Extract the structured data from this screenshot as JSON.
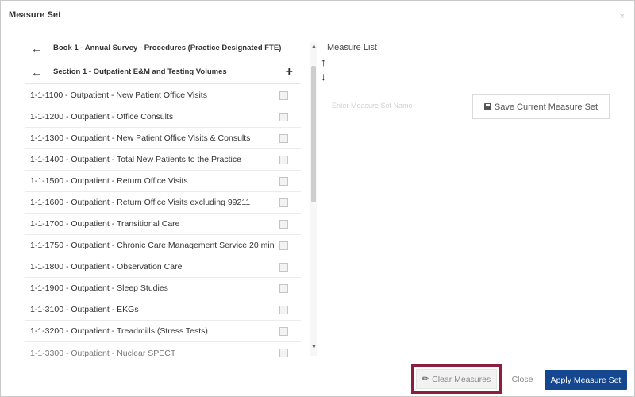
{
  "modal": {
    "title": "Measure Set",
    "close_glyph": "×"
  },
  "left": {
    "book": {
      "back_icon": "←",
      "label": "Book 1 - Annual Survey - Procedures (Practice Designated FTE)"
    },
    "section": {
      "back_icon": "←",
      "label": "Section 1 - Outpatient E&M and Testing Volumes",
      "add_icon": "+"
    },
    "measures": [
      "1-1-1100 - Outpatient - New Patient Office Visits",
      "1-1-1200 - Outpatient - Office Consults",
      "1-1-1300 - Outpatient - New Patient Office Visits & Consults",
      "1-1-1400 - Outpatient - Total New Patients to the Practice",
      "1-1-1500 - Outpatient - Return Office Visits",
      "1-1-1600 - Outpatient - Return Office Visits excluding 99211",
      "1-1-1700 - Outpatient - Transitional Care",
      "1-1-1750 - Outpatient - Chronic Care Management Service 20 min",
      "1-1-1800 - Outpatient - Observation Care",
      "1-1-1900 - Outpatient - Sleep Studies",
      "1-1-3100 - Outpatient - EKGs",
      "1-1-3200 - Outpatient - Treadmills (Stress Tests)",
      "1-1-3300 - Outpatient - Nuclear SPECT"
    ],
    "scroll": {
      "up_glyph": "▲",
      "down_glyph": "▼"
    }
  },
  "right": {
    "measure_list_title": "Measure List",
    "move_up_icon": "↑",
    "move_down_icon": "↓",
    "set_name_placeholder": "Enter Measure Set Name",
    "save_button_label": "Save Current Measure Set"
  },
  "footer": {
    "clear_icon": "eraser-icon",
    "clear_label": "Clear Measures",
    "close_label": "Close",
    "apply_label": "Apply Measure Set"
  },
  "colors": {
    "apply_button": "#14478f",
    "highlight": "#8c1f3d"
  }
}
